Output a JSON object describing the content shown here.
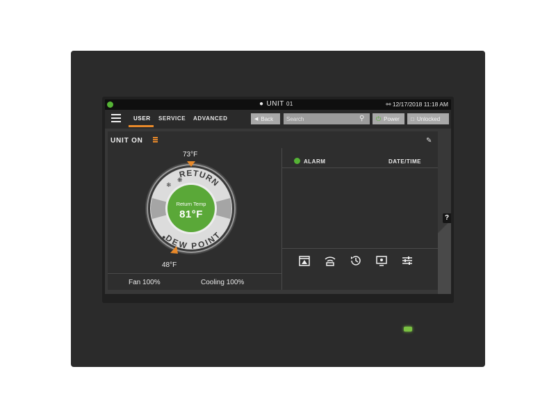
{
  "statusbar": {
    "unit_name": "UNIT",
    "unit_number": "01",
    "datetime": "12/17/2018 11:18 AM"
  },
  "nav": {
    "tabs": [
      "USER",
      "SERVICE",
      "ADVANCED"
    ],
    "active_tab": "USER",
    "back_label": "Back",
    "search_placeholder": "Search",
    "power_label": "Power",
    "lock_label": "Unlocked"
  },
  "unit_status": {
    "label": "UNIT ON"
  },
  "gauge": {
    "top_setpoint": "73°F",
    "bottom_setpoint": "48°F",
    "upper_arc_label": "RETURN",
    "lower_arc_label": "DEW POINT",
    "center_label": "Return Temp",
    "center_value": "81°F"
  },
  "stats": {
    "fan": "Fan 100%",
    "cooling": "Cooling 100%"
  },
  "alarm_panel": {
    "alarm_header": "ALARM",
    "datetime_header": "DATE/TIME"
  },
  "help": {
    "label": "?"
  },
  "colors": {
    "accent_orange": "#e8892a",
    "status_green": "#55b335",
    "gauge_green": "#5aa838",
    "bezel": "#2b2b2b",
    "screen_bg": "#383838"
  },
  "icons": [
    "calendar-alarm-icon",
    "wireless-icon",
    "history-icon",
    "monitor-icon",
    "sliders-icon"
  ]
}
